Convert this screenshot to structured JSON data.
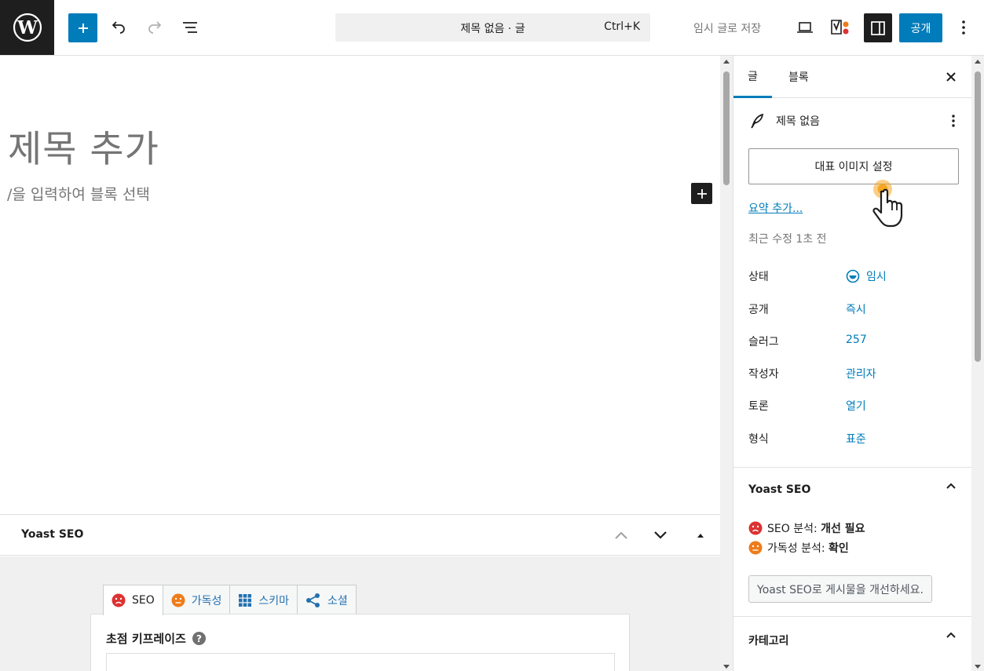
{
  "topbar": {
    "command_title": "제목 없음 · 글",
    "command_shortcut": "Ctrl+K",
    "save_draft": "임시 글로 저장",
    "publish": "공개"
  },
  "editor": {
    "title_placeholder": "제목 추가",
    "block_hint": "/을 입력하여 블록 선택"
  },
  "yoast_box": {
    "label": "Yoast SEO",
    "tabs": [
      {
        "label": "SEO",
        "icon": "sad-face-icon"
      },
      {
        "label": "가독성",
        "icon": "neutral-face-icon"
      },
      {
        "label": "스키마",
        "icon": "grid-icon"
      },
      {
        "label": "소셜",
        "icon": "share-icon"
      }
    ],
    "focus_keyphrase": "초점 키프레이즈"
  },
  "sidebar": {
    "tab_post": "글",
    "tab_block": "블록",
    "post_title": "제목 없음",
    "featured_image": "대표 이미지 설정",
    "add_excerpt": "요약 추가...",
    "last_modified": "최근 수정 1초 전",
    "props": [
      {
        "key": "상태",
        "value": "임시"
      },
      {
        "key": "공개",
        "value": "즉시"
      },
      {
        "key": "슬러그",
        "value": "257"
      },
      {
        "key": "작성자",
        "value": "관리자"
      },
      {
        "key": "토론",
        "value": "열기"
      },
      {
        "key": "형식",
        "value": "표준"
      }
    ],
    "yoast": {
      "title": "Yoast SEO",
      "seo_label": "SEO 분석: ",
      "seo_value": "개선 필요",
      "read_label": "가독성 분석: ",
      "read_value": "확인",
      "improve_btn": "Yoast SEO로 게시물을 개선하세요."
    },
    "category_title": "카테고리"
  },
  "colors": {
    "accent": "#007cba",
    "seo_bad": "#dc3232",
    "readability_ok": "#ee7c1b"
  }
}
